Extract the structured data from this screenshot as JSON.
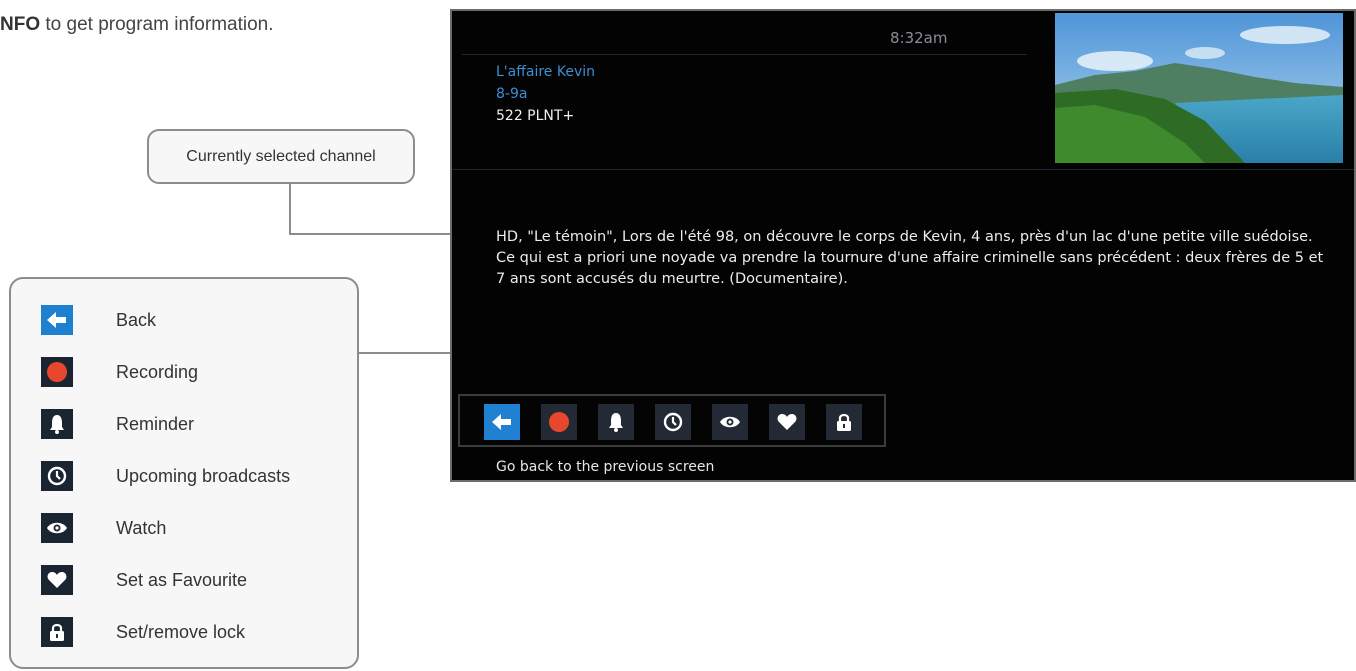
{
  "intro": {
    "bold": "NFO",
    "text": " to get program information."
  },
  "callout": {
    "label": "Currently selected channel"
  },
  "legend": {
    "items": [
      {
        "label": "Back",
        "icon": "back-arrow-icon"
      },
      {
        "label": "Recording",
        "icon": "record-icon"
      },
      {
        "label": "Reminder",
        "icon": "bell-icon"
      },
      {
        "label": "Upcoming broadcasts",
        "icon": "clock-icon"
      },
      {
        "label": "Watch",
        "icon": "eye-icon"
      },
      {
        "label": "Set as Favourite",
        "icon": "heart-icon"
      },
      {
        "label": "Set/remove lock",
        "icon": "lock-icon"
      }
    ]
  },
  "screen": {
    "time": "8:32am",
    "program": {
      "title": "L'affaire Kevin",
      "time": "8-9a",
      "channel": "522 PLNT+"
    },
    "description": "HD, \"Le témoin\", Lors de l'été 98, on découvre le corps de Kevin, 4 ans, près d'un lac d'une petite ville suédoise. Ce qui est a priori une noyade va prendre la tournure d'une affaire criminelle sans précédent : deux frères de 5 et 7 ans sont accusés du meurtre. (Documentaire).",
    "status": "Go back to the previous screen"
  },
  "colors": {
    "accent_blue": "#2080d2",
    "record_red": "#e8472e",
    "text_blue": "#3d8fd6",
    "button_bg": "#232a35"
  }
}
